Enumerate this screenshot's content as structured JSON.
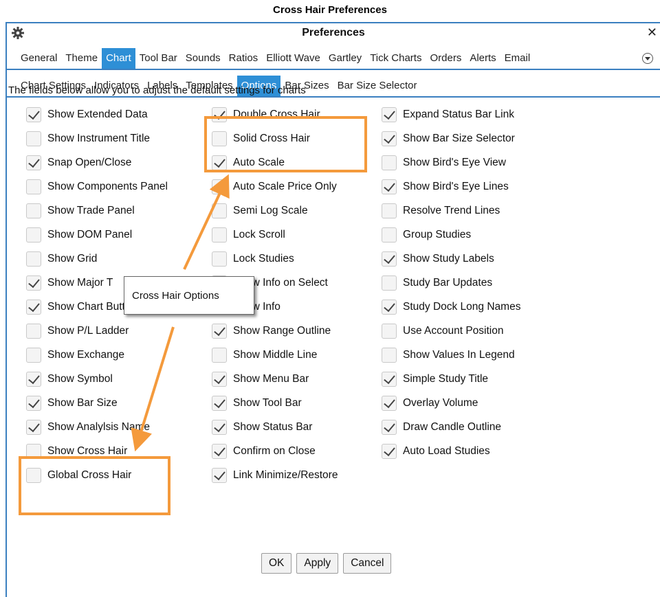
{
  "caption": "Cross Hair Preferences",
  "window": {
    "title": "Preferences",
    "close_glyph": "✕",
    "icon": "gear-icon",
    "more_icon": "chevron-down-circle-icon"
  },
  "main_tabs": [
    "General",
    "Theme",
    "Chart",
    "Tool Bar",
    "Sounds",
    "Ratios",
    "Elliott Wave",
    "Gartley",
    "Tick Charts",
    "Orders",
    "Alerts",
    "Email"
  ],
  "main_tab_active": "Chart",
  "sub_tabs": [
    "Chart Settings",
    "Indicators",
    "Labels",
    "Templates",
    "Options",
    "Bar Sizes",
    "Bar Size Selector"
  ],
  "sub_tab_active": "Options",
  "description": "The fields below allow you to adjust the default settings for charts",
  "columns": [
    [
      {
        "label": "Show Extended Data",
        "checked": true
      },
      {
        "label": "Show Instrument Title",
        "checked": false
      },
      {
        "label": "Snap Open/Close",
        "checked": true
      },
      {
        "label": "Show Components Panel",
        "checked": false
      },
      {
        "label": "Show Trade Panel",
        "checked": false
      },
      {
        "label": "Show DOM Panel",
        "checked": false
      },
      {
        "label": "Show Grid",
        "checked": false
      },
      {
        "label": "Show Major T",
        "checked": true
      },
      {
        "label": "Show Chart Buttons",
        "checked": true
      },
      {
        "label": "Show P/L Ladder",
        "checked": false
      },
      {
        "label": "Show Exchange",
        "checked": false
      },
      {
        "label": "Show Symbol",
        "checked": true
      },
      {
        "label": "Show Bar Size",
        "checked": true
      },
      {
        "label": "Show Analylsis Name",
        "checked": true
      },
      {
        "label": "Show Cross Hair",
        "checked": false
      },
      {
        "label": "Global Cross Hair",
        "checked": false
      }
    ],
    [
      {
        "label": "Double Cross Hair",
        "checked": true
      },
      {
        "label": "Solid Cross Hair",
        "checked": false
      },
      {
        "label": "Auto Scale",
        "checked": true
      },
      {
        "label": "Auto Scale Price Only",
        "checked": false
      },
      {
        "label": "Semi Log Scale",
        "checked": false
      },
      {
        "label": "Lock Scroll",
        "checked": false
      },
      {
        "label": "Lock Studies",
        "checked": false
      },
      {
        "label": "Show Info on Select",
        "checked": false
      },
      {
        "label": "Show Info",
        "checked": false
      },
      {
        "label": "Show Range Outline",
        "checked": true
      },
      {
        "label": "Show Middle Line",
        "checked": false
      },
      {
        "label": "Show Menu Bar",
        "checked": true
      },
      {
        "label": "Show Tool Bar",
        "checked": true
      },
      {
        "label": "Show Status Bar",
        "checked": true
      },
      {
        "label": "Confirm on Close",
        "checked": true
      },
      {
        "label": "Link Minimize/Restore",
        "checked": true
      }
    ],
    [
      {
        "label": "Expand Status Bar Link",
        "checked": true
      },
      {
        "label": "Show Bar Size Selector",
        "checked": true
      },
      {
        "label": "Show Bird's Eye View",
        "checked": false
      },
      {
        "label": "Show Bird's Eye Lines",
        "checked": true
      },
      {
        "label": "Resolve Trend Lines",
        "checked": false
      },
      {
        "label": "Group Studies",
        "checked": false
      },
      {
        "label": "Show Study Labels",
        "checked": true
      },
      {
        "label": "Study Bar Updates",
        "checked": false
      },
      {
        "label": "Study Dock Long Names",
        "checked": true
      },
      {
        "label": "Use Account Position",
        "checked": false
      },
      {
        "label": "Show Values In Legend",
        "checked": false
      },
      {
        "label": "Simple Study Title",
        "checked": true
      },
      {
        "label": "Overlay Volume",
        "checked": true
      },
      {
        "label": "Draw Candle Outline",
        "checked": true
      },
      {
        "label": "Auto Load Studies",
        "checked": true
      }
    ]
  ],
  "buttons": {
    "ok": "OK",
    "apply": "Apply",
    "cancel": "Cancel"
  },
  "callout": "Cross Hair Options",
  "annotation_color": "#f49a3c",
  "accent_color": "#2e8fd6"
}
